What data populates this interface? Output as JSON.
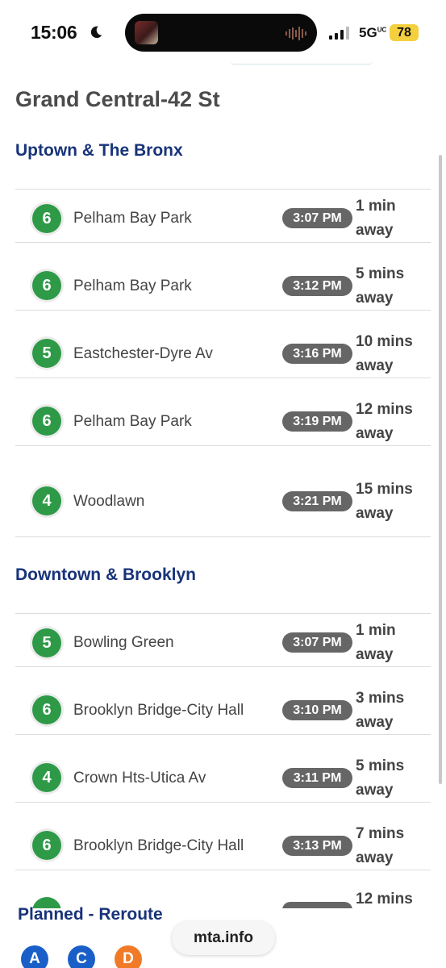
{
  "status_bar": {
    "time": "15:06",
    "network": "5G",
    "network_sup": "UC",
    "battery": "78",
    "icons": [
      "moon-icon",
      "album-art",
      "waveform-icon",
      "signal-icon"
    ]
  },
  "station": {
    "title": "Grand Central-42 St"
  },
  "uptown": {
    "heading": "Uptown & The Bronx",
    "trains": [
      {
        "line": "6",
        "destination": "Pelham Bay Park",
        "time": "3:07 PM",
        "away_1": "1 min",
        "away_2": "away"
      },
      {
        "line": "6",
        "destination": "Pelham Bay Park",
        "time": "3:12 PM",
        "away_1": "5 mins",
        "away_2": "away"
      },
      {
        "line": "5",
        "destination": "Eastchester-Dyre Av",
        "time": "3:16 PM",
        "away_1": "10 mins",
        "away_2": "away"
      },
      {
        "line": "6",
        "destination": "Pelham Bay Park",
        "time": "3:19 PM",
        "away_1": "12 mins",
        "away_2": "away"
      },
      {
        "line": "4",
        "destination": "Woodlawn",
        "time": "3:21 PM",
        "away_1": "15 mins",
        "away_2": "away"
      }
    ]
  },
  "downtown": {
    "heading": "Downtown & Brooklyn",
    "trains": [
      {
        "line": "5",
        "destination": "Bowling Green",
        "time": "3:07 PM",
        "away_1": "1 min",
        "away_2": "away"
      },
      {
        "line": "6",
        "destination": "Brooklyn Bridge-City Hall",
        "time": "3:10 PM",
        "away_1": "3 mins",
        "away_2": "away"
      },
      {
        "line": "4",
        "destination": "Crown Hts-Utica Av",
        "time": "3:11 PM",
        "away_1": "5 mins",
        "away_2": "away"
      },
      {
        "line": "6",
        "destination": "Brooklyn Bridge-City Hall",
        "time": "3:13 PM",
        "away_1": "7 mins",
        "away_2": "away"
      }
    ],
    "partial_away": "12 mins"
  },
  "planned": {
    "heading": "Planned - Reroute",
    "lines": [
      "A",
      "C",
      "D"
    ]
  },
  "browser": {
    "url": "mta.info"
  },
  "colors": {
    "line_green": "#2e9a47",
    "heading_blue": "#18337a",
    "line_blue": "#1a5fc7",
    "line_orange": "#f07a28",
    "pill_gray": "#666666",
    "battery_yellow": "#f4d03f"
  }
}
